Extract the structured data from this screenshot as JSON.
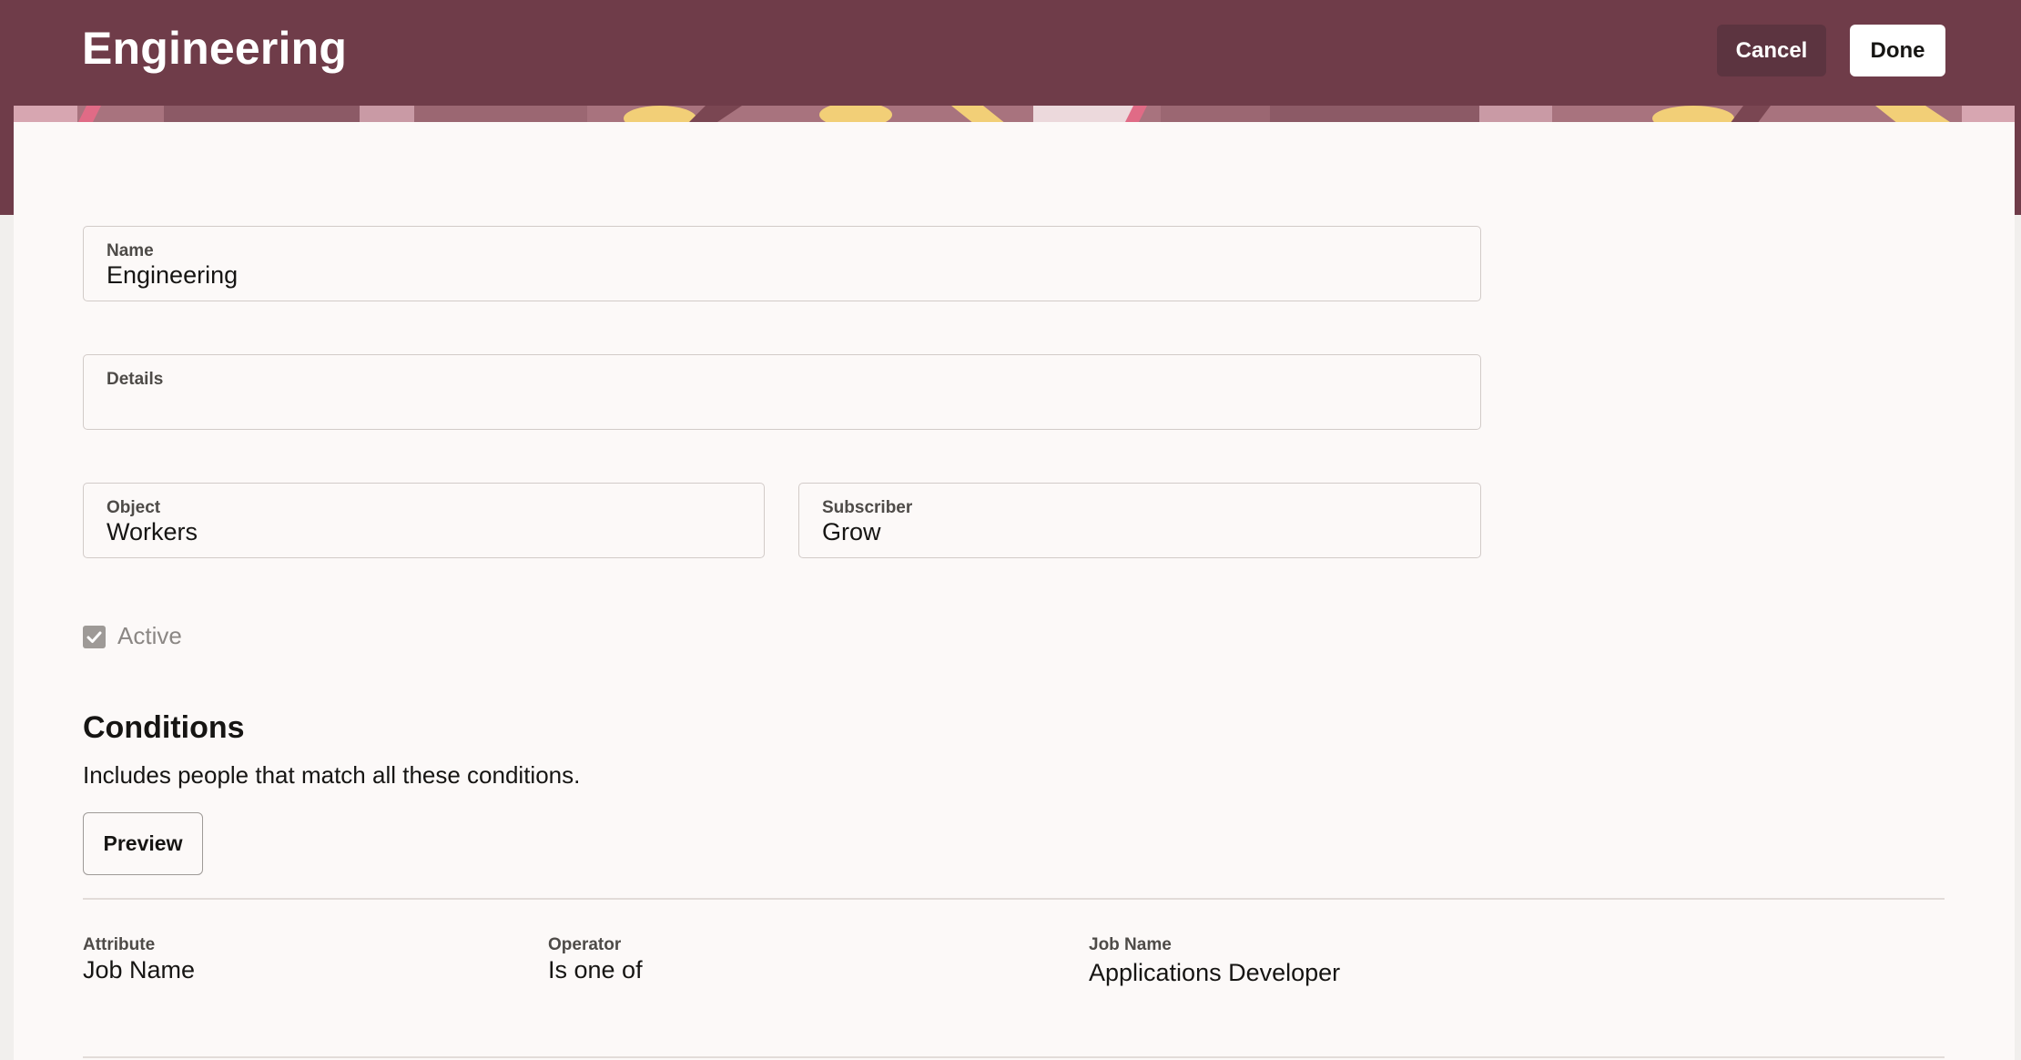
{
  "header": {
    "title": "Engineering",
    "cancel_label": "Cancel",
    "done_label": "Done"
  },
  "form": {
    "name": {
      "label": "Name",
      "value": "Engineering"
    },
    "details": {
      "label": "Details",
      "value": ""
    },
    "object": {
      "label": "Object",
      "value": "Workers"
    },
    "subscriber": {
      "label": "Subscriber",
      "value": "Grow"
    },
    "active": {
      "label": "Active",
      "checked": true
    }
  },
  "conditions": {
    "title": "Conditions",
    "description": "Includes people that match all these conditions.",
    "preview_label": "Preview",
    "rows": [
      {
        "attribute_label": "Attribute",
        "attribute": "Job Name",
        "operator_label": "Operator",
        "operator": "Is one of",
        "value_label": "Job Name",
        "value": "Applications Developer"
      }
    ]
  },
  "colors": {
    "header_bg": "#6f3c49",
    "card_bg": "#fcf9f8",
    "banner_accent_yellow": "#f2cf77",
    "banner_accent_pink": "#e06b86"
  }
}
